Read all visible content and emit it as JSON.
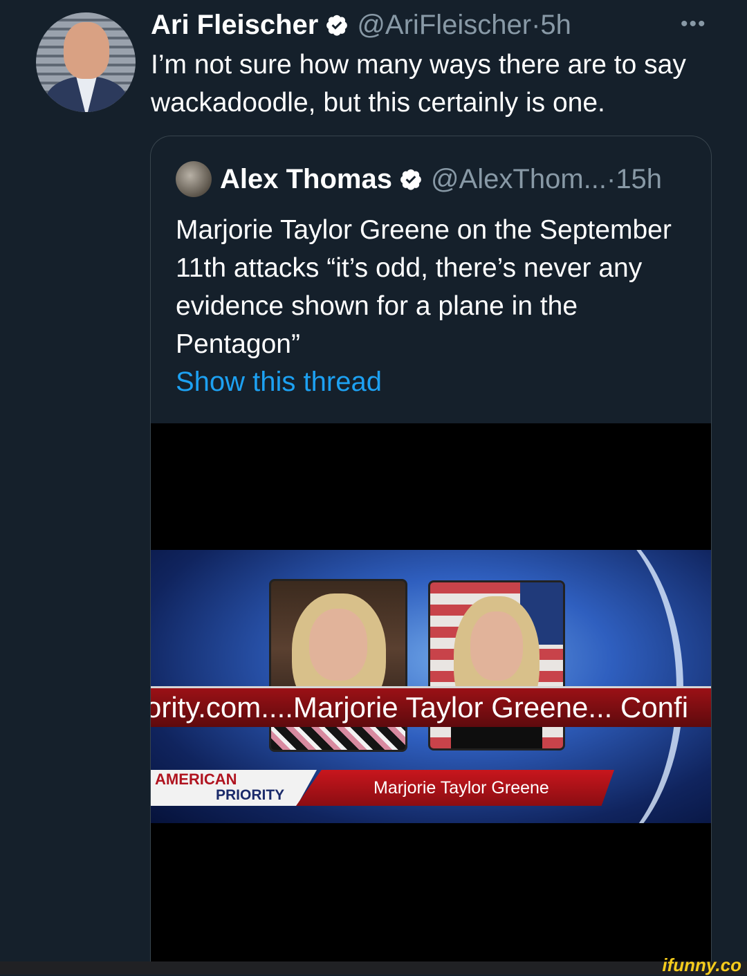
{
  "tweet": {
    "author_name": "Ari Fleischer",
    "handle": "@AriFleischer",
    "separator": " · ",
    "time": "5h",
    "more_label": "•••",
    "text": "I’m not sure how many ways there are to say wackadoodle, but this certainly is one."
  },
  "quoted": {
    "author_name": "Alex Thomas",
    "handle": "@AlexThom...",
    "separator": " · ",
    "time": "15h",
    "text": "Marjorie Taylor Greene on the September 11th attacks “it’s odd, there’s never any evidence shown for a plane in the Pentagon”",
    "show_thread": "Show this thread"
  },
  "video": {
    "brand_line1": "AMERICAN",
    "brand_line2": "PRIORITY",
    "lower_third_name": "Marjorie Taylor Greene",
    "ticker": "ority.com....Marjorie Taylor Greene... Confi"
  },
  "watermark": "ifunny.co",
  "colors": {
    "background": "#15202b",
    "link": "#1da1f2",
    "secondary_text": "#8899a6",
    "verified": "#ffffff"
  },
  "icons": {
    "verified": "verified-badge-icon",
    "more": "more-horizontal-icon"
  }
}
